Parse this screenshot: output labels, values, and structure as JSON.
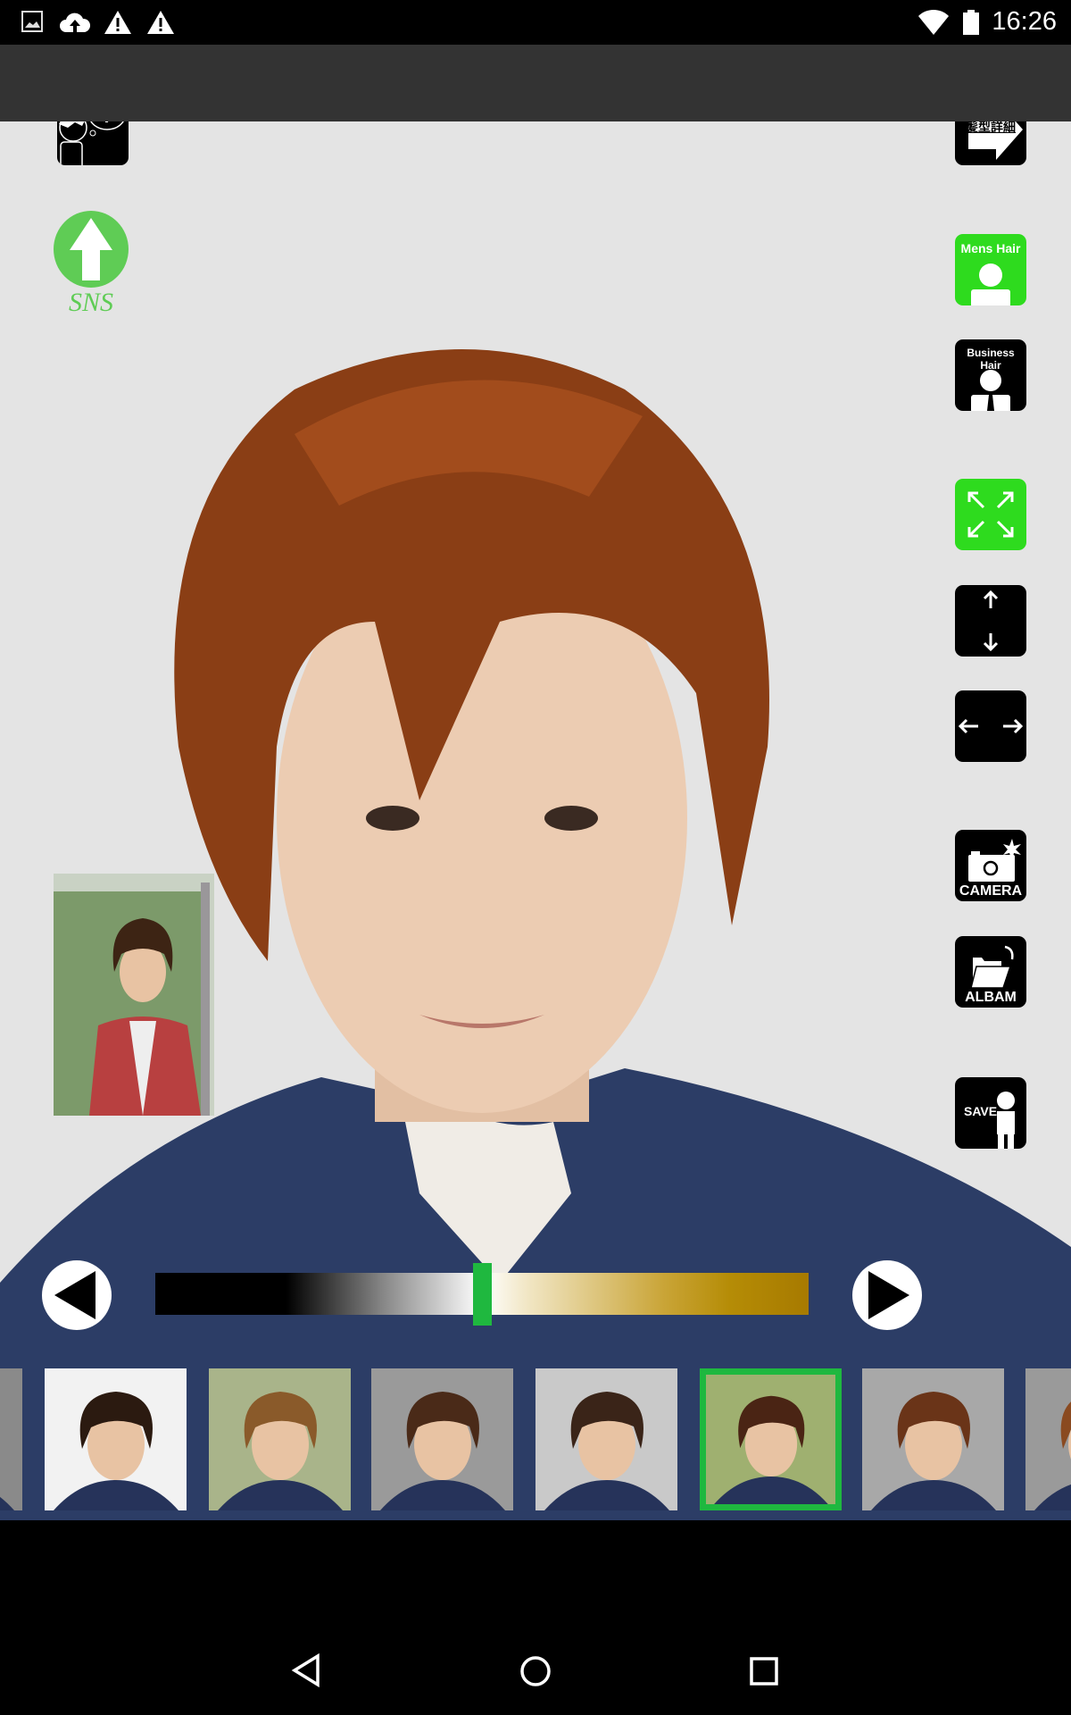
{
  "status_bar": {
    "time": "16:26",
    "icons": [
      "image-icon",
      "cloud-upload-icon",
      "warning-icon",
      "warning-icon",
      "wifi-icon",
      "battery-icon"
    ]
  },
  "left_buttons": {
    "help_icon": "person-thinking-question-icon",
    "sns_label": "SNS",
    "sns_color": "#5fcc55"
  },
  "right_buttons": {
    "detail_label": "髪型詳細",
    "mens_hair_label": "Mens Hair",
    "business_hair_label": "Business Hair",
    "expand_icon": "expand-arrows-icon",
    "vertical_icon": "vertical-resize-icon",
    "horizontal_icon": "horizontal-resize-icon",
    "camera_label": "CAMERA",
    "album_label": "ALBAM",
    "save_label": "SAVE"
  },
  "color_slider": {
    "value_percent": 50,
    "handle_color": "#1fb83f"
  },
  "hairstyle_strip": {
    "count_visible": 8,
    "selected_index": 5,
    "selected_color": "#1fb83f"
  },
  "colors": {
    "accent_green": "#2edb1e",
    "background": "#e4e4e4"
  }
}
